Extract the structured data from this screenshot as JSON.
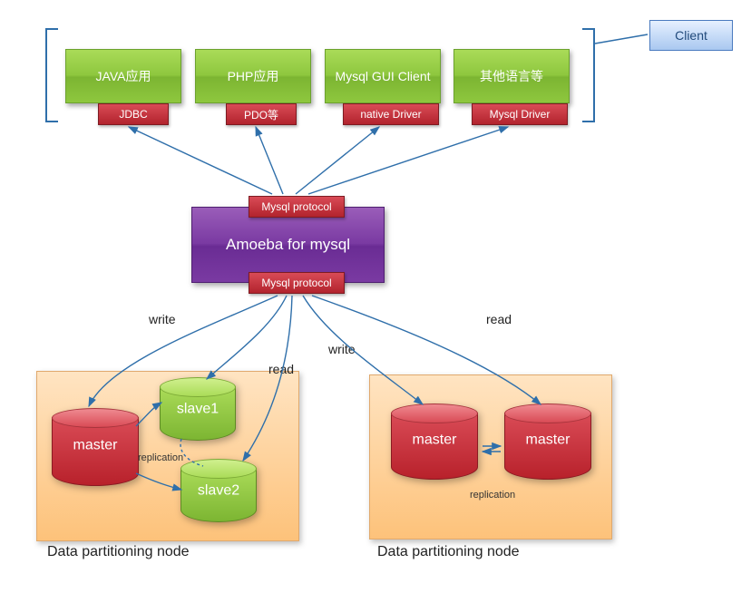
{
  "client": {
    "label": "Client"
  },
  "apps": [
    {
      "title": "JAVA应用",
      "driver": "JDBC"
    },
    {
      "title": "PHP应用",
      "driver": "PDO等"
    },
    {
      "title": "Mysql GUI Client",
      "driver": "native Driver"
    },
    {
      "title": "其他语言等",
      "driver": "Mysql Driver"
    }
  ],
  "amoeba": {
    "title": "Amoeba for mysql",
    "protocol_top": "Mysql protocol",
    "protocol_bottom": "Mysql protocol"
  },
  "labels": {
    "write": "write",
    "read": "read",
    "replication": "replication",
    "partition": "Data partitioning node"
  },
  "partition_left": {
    "cylinders": [
      {
        "name": "master",
        "color": "red"
      },
      {
        "name": "slave1",
        "color": "green"
      },
      {
        "name": "slave2",
        "color": "green"
      }
    ]
  },
  "partition_right": {
    "cylinders": [
      {
        "name": "master",
        "color": "red"
      },
      {
        "name": "master",
        "color": "red"
      }
    ]
  },
  "colors": {
    "green": "#8ec73e",
    "red": "#c0392b",
    "purple": "#7a3aa2",
    "orange": "#fdc27a",
    "arrow": "#2f6faa"
  }
}
